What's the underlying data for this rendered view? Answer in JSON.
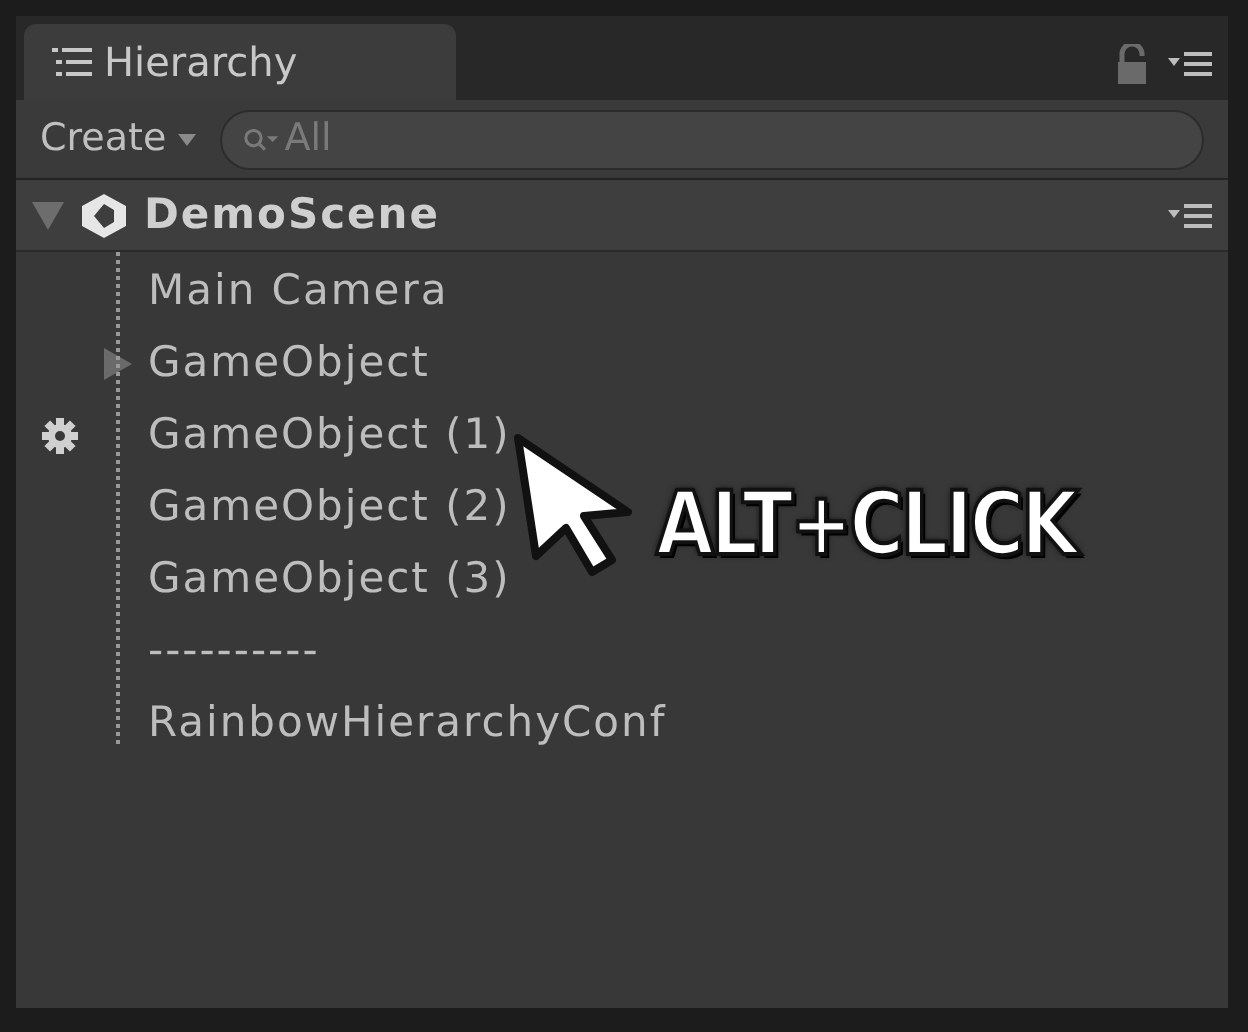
{
  "tab": {
    "label": "Hierarchy"
  },
  "toolbar": {
    "create_button": "Create",
    "search": {
      "placeholder": "All"
    }
  },
  "scene": {
    "name": "DemoScene",
    "expanded": true
  },
  "items": [
    {
      "label": "Main Camera",
      "expandable": false,
      "gear": false
    },
    {
      "label": "GameObject",
      "expandable": true,
      "gear": false
    },
    {
      "label": "GameObject (1)",
      "expandable": false,
      "gear": true
    },
    {
      "label": "GameObject (2)",
      "expandable": false,
      "gear": false
    },
    {
      "label": "GameObject (3)",
      "expandable": false,
      "gear": false
    },
    {
      "label": "----------",
      "expandable": false,
      "gear": false
    },
    {
      "label": "RainbowHierarchyConf",
      "expandable": false,
      "gear": false
    }
  ],
  "overlay": {
    "hint": "ALT+CLICK"
  }
}
